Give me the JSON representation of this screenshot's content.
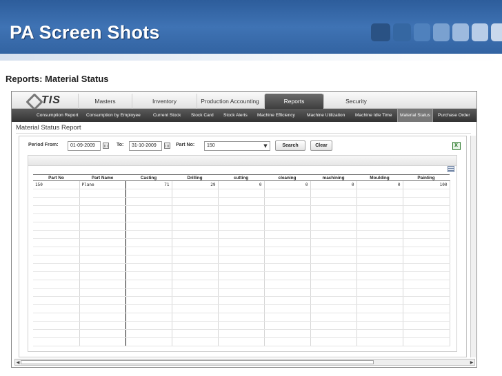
{
  "slide": {
    "title": "PA Screen Shots",
    "subtitle": "Reports: Material Status"
  },
  "app": {
    "logo_text": "TIS",
    "main_tabs": [
      "Masters",
      "Inventory",
      "Production Accounting",
      "Reports",
      "Security"
    ],
    "active_main_tab": "Reports",
    "sub_menu": [
      "Consumption Report",
      "Consumption by Employee",
      "Current Stock",
      "Stock Card",
      "Stock Alerts",
      "Machine Efficiency",
      "Machine Utilization",
      "Machine Idle Time",
      "Material Status",
      "Purchase Order"
    ],
    "active_sub_menu": "Material Status",
    "report_title": "Material Status Report",
    "filters": {
      "period_from_label": "Period From:",
      "period_from_value": "01-09-2009",
      "to_label": "To:",
      "to_value": "31-10-2009",
      "part_no_label": "Part No:",
      "part_no_value": "150",
      "search_label": "Search",
      "clear_label": "Clear"
    },
    "grid": {
      "columns": [
        "Part No",
        "Part Name",
        "Casting",
        "Drilling",
        "cutting",
        "cleaning",
        "machining",
        "Moulding",
        "Painting"
      ],
      "rows": [
        [
          "150",
          "Plane",
          "71",
          "29",
          "0",
          "0",
          "0",
          "0",
          "100"
        ]
      ],
      "empty_rows": 19
    }
  }
}
